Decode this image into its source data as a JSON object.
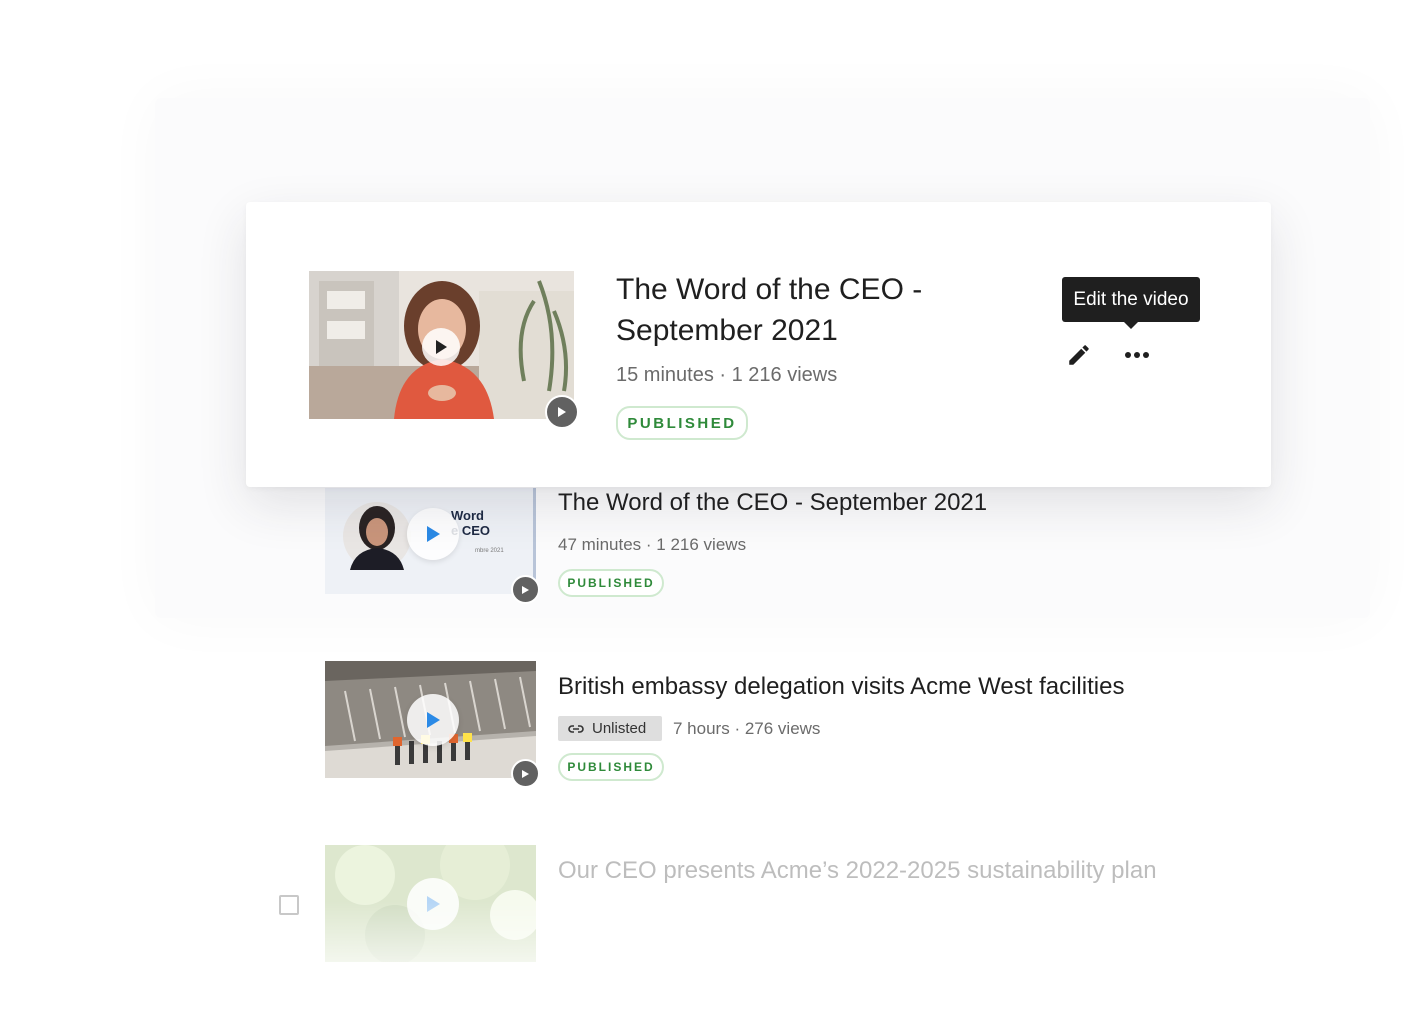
{
  "tooltip": {
    "text": "Edit the video"
  },
  "featured": {
    "title_line1": "The Word of the CEO -",
    "title_line2": "September 2021",
    "duration": "15 minutes",
    "views": "1 216 views",
    "status": "PUBLISHED"
  },
  "videos": [
    {
      "title": "The Word of the CEO - September 2021",
      "duration": "47 minutes",
      "views": "1 216 views",
      "status": "PUBLISHED",
      "thumb_text_1": "Word",
      "thumb_text_2": "e CEO"
    },
    {
      "title": "British embassy delegation visits Acme West facilities",
      "visibility": "Unlisted",
      "duration": "7 hours",
      "views": "276 views",
      "status": "PUBLISHED"
    },
    {
      "title": "Our CEO presents Acme’s 2022-2025 sustainability plan"
    }
  ],
  "colors": {
    "published_green": "#2f8a3a",
    "play_blue": "#2b8ae6",
    "tooltip_bg": "#1f1f1f"
  }
}
